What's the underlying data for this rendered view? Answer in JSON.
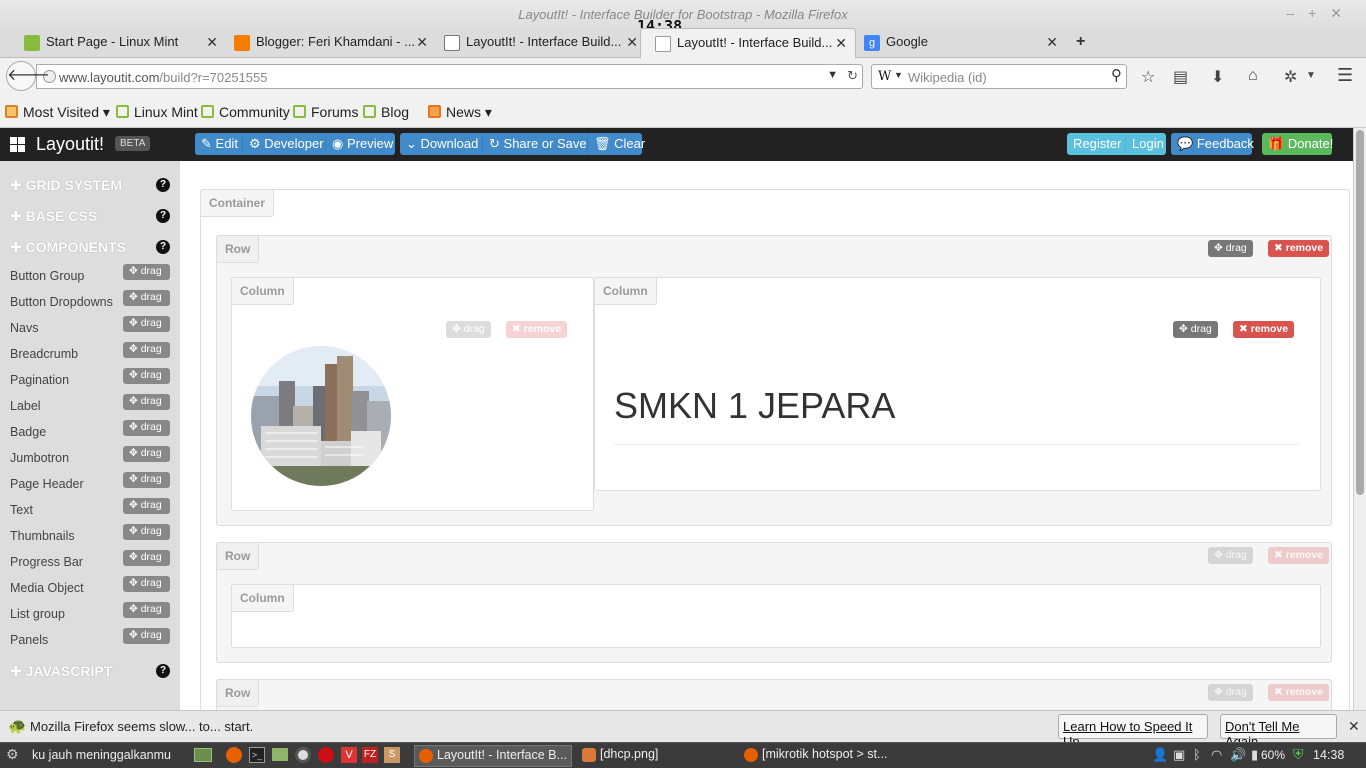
{
  "window": {
    "title": "LayoutIt! - Interface Builder for Bootstrap - Mozilla Firefox",
    "clock_overlay": "14:38"
  },
  "tabs": [
    {
      "label": "Start Page - Linux Mint",
      "icon": "linuxmint-icon"
    },
    {
      "label": "Blogger: Feri Khamdani - ...",
      "icon": "blogger-icon"
    },
    {
      "label": "LayoutIt! - Interface Build...",
      "icon": "layoutit-icon"
    },
    {
      "label": "LayoutIt! - Interface Build...",
      "icon": "layoutit-icon",
      "active": true
    },
    {
      "label": "Google",
      "icon": "google-icon"
    }
  ],
  "nav": {
    "url_host": "www.layoutit.com",
    "url_path": "/build?r=70251555",
    "search_engine": "W",
    "search_placeholder": "Wikipedia (id)"
  },
  "bookmarks": [
    {
      "label": "Most Visited",
      "dropdown": true
    },
    {
      "label": "Linux Mint"
    },
    {
      "label": "Community"
    },
    {
      "label": "Forums"
    },
    {
      "label": "Blog"
    },
    {
      "label": "News",
      "dropdown": true
    }
  ],
  "app": {
    "brand": "Layoutit!",
    "beta": "BETA",
    "toolbar": {
      "edit": "Edit",
      "developer": "Developer",
      "preview": "Preview",
      "download": "Download",
      "share": "Share or Save",
      "clear": "Clear",
      "register": "Register",
      "login": "Login",
      "feedback": "Feedback",
      "donate": "Donate!"
    }
  },
  "sidebar": {
    "sections": [
      "GRID SYSTEM",
      "BASE CSS",
      "COMPONENTS",
      "JAVASCRIPT"
    ],
    "help": "?",
    "drag_label": "drag",
    "components": [
      "Button Group",
      "Button Dropdowns",
      "Navs",
      "Breadcrumb",
      "Pagination",
      "Label",
      "Badge",
      "Jumbotron",
      "Page Header",
      "Text",
      "Thumbnails",
      "Progress Bar",
      "Media Object",
      "List group",
      "Panels"
    ]
  },
  "canvas": {
    "container_label": "Container",
    "row_label": "Row",
    "column_label": "Column",
    "drag_label": "drag",
    "remove_label": "remove",
    "heading": "SMKN 1 JEPARA"
  },
  "notification": {
    "message": "Mozilla Firefox seems slow... to... start.",
    "learn_button": "Learn How to Speed It Up",
    "dismiss_button": "Don't Tell Me Again"
  },
  "taskbar": {
    "start_label": "ku jauh meninggalkanmu",
    "tasks": [
      {
        "label": "LayoutIt! - Interface B...",
        "active": true
      },
      {
        "label": "[dhcp.png]"
      },
      {
        "label": "[mikrotik hotspot > st..."
      }
    ],
    "battery": "60%",
    "clock": "14:38"
  },
  "colors": {
    "bootstrap_primary": "#428bca",
    "bootstrap_info": "#5bc0de",
    "bootstrap_success": "#5cb85c",
    "bootstrap_danger": "#d9534f",
    "navbar_dark": "#222222"
  }
}
